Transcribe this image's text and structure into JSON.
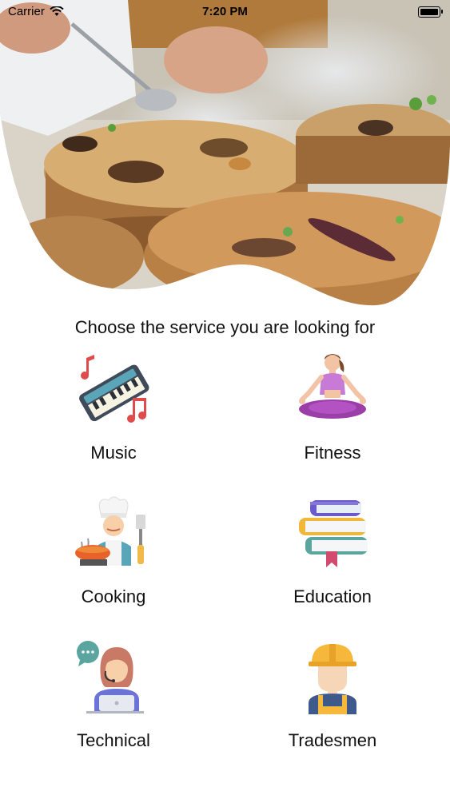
{
  "status_bar": {
    "carrier": "Carrier",
    "time": "7:20 PM"
  },
  "hero": {
    "image_icon": "food-plating-photo"
  },
  "prompt": "Choose the service you are looking for",
  "services": [
    {
      "label": "Music",
      "icon": "music-keyboard-icon"
    },
    {
      "label": "Fitness",
      "icon": "yoga-icon"
    },
    {
      "label": "Cooking",
      "icon": "chef-icon"
    },
    {
      "label": "Education",
      "icon": "books-icon"
    },
    {
      "label": "Technical",
      "icon": "support-agent-icon"
    },
    {
      "label": "Tradesmen",
      "icon": "worker-icon"
    }
  ]
}
